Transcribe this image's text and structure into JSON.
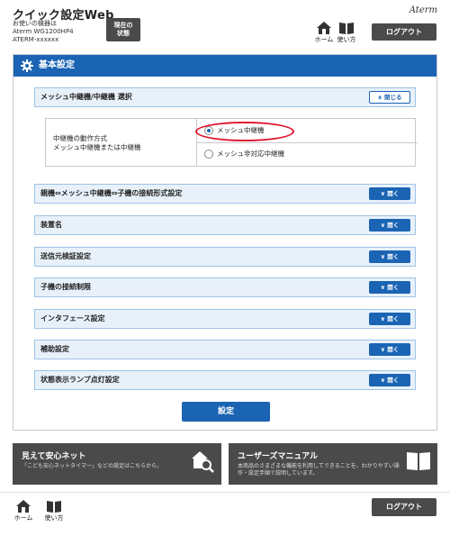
{
  "header": {
    "app_title": "クイック設定Web",
    "device_line1": "お使いの機器は",
    "device_line2": "Aterm WG1200HP4",
    "device_line3": "ATERM-xxxxxx",
    "status_line1": "現在の",
    "status_line2": "状態",
    "brand": "Aterm",
    "home_label": "ホーム",
    "manual_label": "使い方",
    "logout_label": "ログアウト"
  },
  "main": {
    "section_title": "基本設定",
    "mesh_title": "メッシュ中継機/中継機 選択",
    "close_label": "∧ 閉じる",
    "mesh_label_line1": "中継機の動作方式",
    "mesh_label_line2": "メッシュ中継機または中継機",
    "option_mesh": "メッシュ中継機",
    "option_non_mesh": "メッシュ非対応中継機",
    "open_label": "∨ 開く",
    "accordions": [
      "親機⇔メッシュ中継機⇔子機の接続形式設定",
      "装置名",
      "送信元検証設定",
      "子機の接続制限",
      "インタフェース設定",
      "補助設定",
      "状態表示ランプ点灯設定"
    ],
    "set_label": "設定"
  },
  "cards": {
    "safety_title": "見えて安心ネット",
    "safety_desc": "「こども安心ネットタイマー」などの設定はこちらから。",
    "manual_title": "ユーザーズマニュアル",
    "manual_desc_line1": "本商品のさまざまな機能を利用してできることを、わかりやすい操",
    "manual_desc_line2": "作・設定手順で説明しています。"
  },
  "footer": {
    "home_label": "ホーム",
    "manual_label": "使い方",
    "logout_label": "ログアウト"
  },
  "colors": {
    "primary": "#1b64b4",
    "dark": "#4a4a4a",
    "highlight": "#e0102a"
  }
}
